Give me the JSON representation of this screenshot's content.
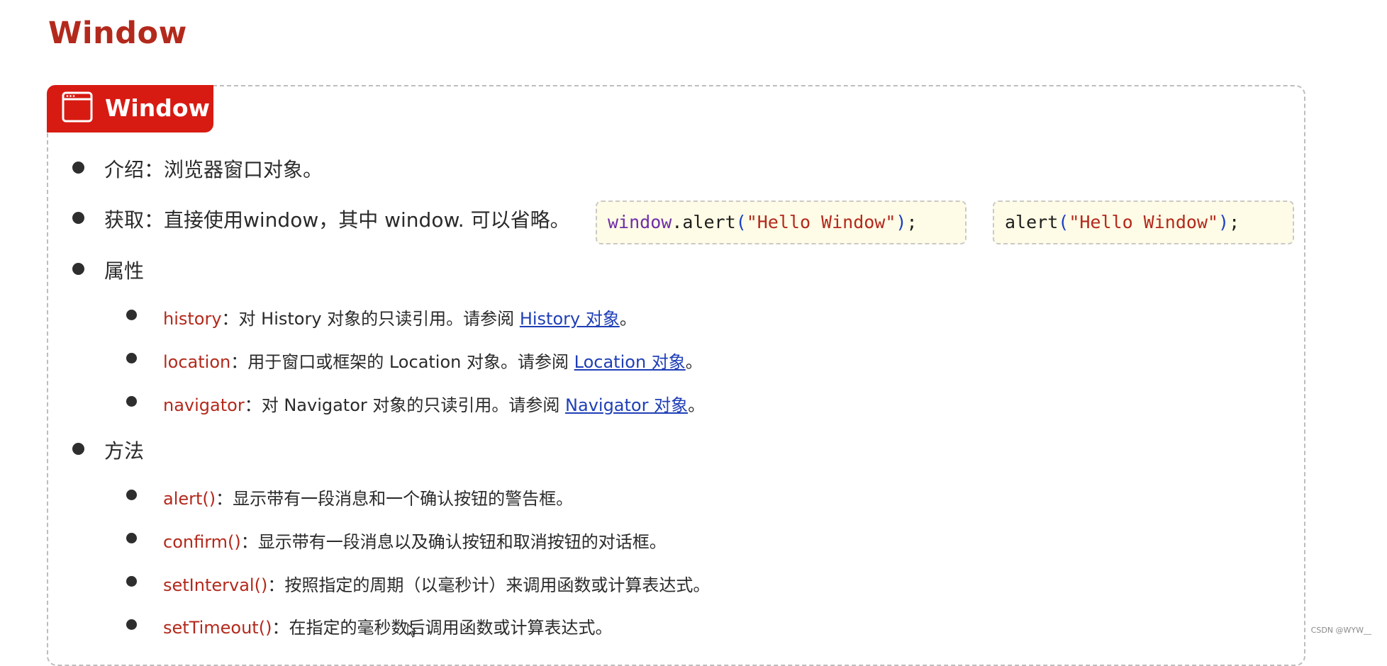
{
  "page": {
    "title": "Window"
  },
  "tab": {
    "label": "Window",
    "icon": "browser-window-icon"
  },
  "items": {
    "intro": {
      "text": "介绍：浏览器窗口对象。"
    },
    "obtain": {
      "text": "获取：直接使用window，其中 window. 可以省略。"
    },
    "props_heading": "属性",
    "methods_heading": "方法"
  },
  "code": {
    "box1": {
      "obj": "window",
      "dot_fn": ".alert",
      "open": "(",
      "str": "\"Hello Window\"",
      "close": ")",
      "semi": ";"
    },
    "box2": {
      "fn": "alert",
      "open": "(",
      "str": "\"Hello Window\"",
      "close": ")",
      "semi": ";"
    }
  },
  "properties": [
    {
      "name": "history",
      "desc": "：对 History 对象的只读引用。请参阅 ",
      "link": "History 对象",
      "end": "。"
    },
    {
      "name": "location",
      "desc": "：用于窗口或框架的 Location 对象。请参阅 ",
      "link": "Location 对象",
      "end": "。"
    },
    {
      "name": "navigator",
      "desc": "：对 Navigator 对象的只读引用。请参阅 ",
      "link": "Navigator 对象",
      "end": "。"
    }
  ],
  "methods": [
    {
      "name": "alert()",
      "desc": "：显示带有一段消息和一个确认按钮的警告框。"
    },
    {
      "name": "confirm()",
      "desc": "：显示带有一段消息以及确认按钮和取消按钮的对话框。"
    },
    {
      "name": "setInterval()",
      "desc": "：按照指定的周期（以毫秒计）来调用函数或计算表达式。"
    },
    {
      "name": "setTimeout()",
      "desc": "：在指定的毫秒数后调用函数或计算表达式。"
    }
  ],
  "watermark": "CSDN @WYW__",
  "colors": {
    "title": "#b3291c",
    "tab_bg": "#d71b12",
    "keyword": "#b3291c",
    "link": "#1f3fb7",
    "code_bg": "#fefbe6"
  }
}
